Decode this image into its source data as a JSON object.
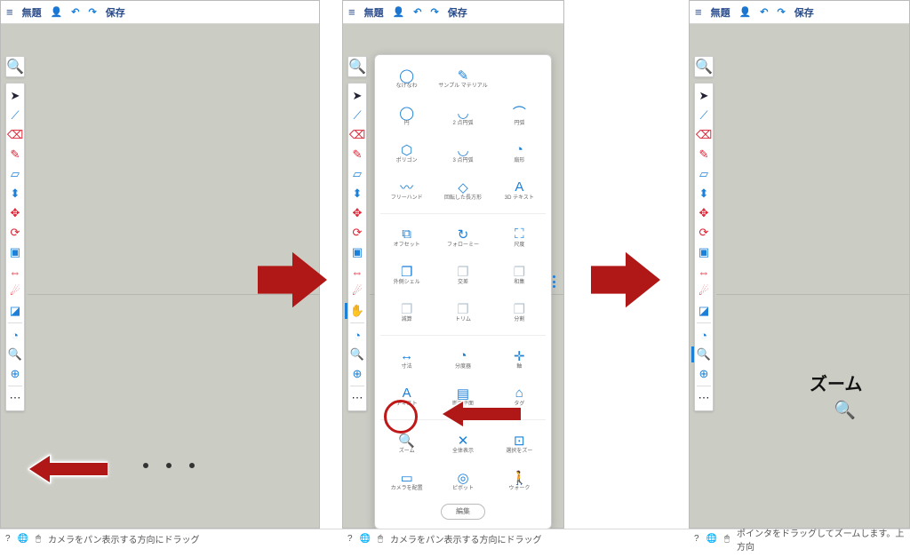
{
  "header": {
    "title": "無題",
    "save": "保存"
  },
  "status": {
    "pan_hint": "カメラをパン表示する方向にドラッグ",
    "zoom_hint": "ポインタをドラッグしてズームします。上方向"
  },
  "highlight": {
    "label": "ズーム"
  },
  "popup": {
    "edit": "編集",
    "groups": [
      [
        {
          "icon": "lasso",
          "label": "なげなわ"
        },
        {
          "icon": "dropper",
          "label": "サンプル マテリアル"
        },
        {
          "icon": "",
          "label": ""
        }
      ],
      [
        {
          "icon": "circle",
          "label": "円"
        },
        {
          "icon": "arc2",
          "label": "2 点円弧"
        },
        {
          "icon": "arc",
          "label": "円弧"
        }
      ],
      [
        {
          "icon": "polygon",
          "label": "ポリゴン"
        },
        {
          "icon": "arc3",
          "label": "3 点円弧"
        },
        {
          "icon": "pie",
          "label": "扇形"
        }
      ],
      [
        {
          "icon": "freehand",
          "label": "フリーハンド"
        },
        {
          "icon": "rotrect",
          "label": "回転した長方形"
        },
        {
          "icon": "text3d",
          "label": "3D テキスト"
        }
      ],
      [
        {
          "icon": "offset",
          "label": "オフセット"
        },
        {
          "icon": "followme",
          "label": "フォローミー"
        },
        {
          "icon": "scale",
          "label": "尺度"
        }
      ],
      [
        {
          "icon": "outershell",
          "label": "外側シェル"
        },
        {
          "icon": "union",
          "label": "交差",
          "dim": true
        },
        {
          "icon": "union2",
          "label": "和集",
          "dim": true
        }
      ],
      [
        {
          "icon": "subtract",
          "label": "減算",
          "dim": true
        },
        {
          "icon": "trim",
          "label": "トリム",
          "dim": true
        },
        {
          "icon": "split",
          "label": "分割",
          "dim": true
        }
      ],
      [
        {
          "icon": "dim",
          "label": "寸法"
        },
        {
          "icon": "protractor",
          "label": "分度器"
        },
        {
          "icon": "axes",
          "label": "軸"
        }
      ],
      [
        {
          "icon": "text",
          "label": "テキスト"
        },
        {
          "icon": "section",
          "label": "断面平面"
        },
        {
          "icon": "tag",
          "label": "タグ"
        }
      ],
      [
        {
          "icon": "zoom",
          "label": "ズーム"
        },
        {
          "icon": "zoomext",
          "label": "全体表示"
        },
        {
          "icon": "zoomwin",
          "label": "選択をズー"
        }
      ],
      [
        {
          "icon": "position",
          "label": "カメラを配置"
        },
        {
          "icon": "pivot",
          "label": "ピボット"
        },
        {
          "icon": "walk",
          "label": "ウォーク"
        }
      ]
    ]
  },
  "toolbar_icons": [
    "select",
    "line",
    "eraser",
    "pencil",
    "rectangle",
    "pushpull",
    "move",
    "rotate",
    "colorize",
    "tape",
    "pan",
    "orbit",
    "more"
  ]
}
